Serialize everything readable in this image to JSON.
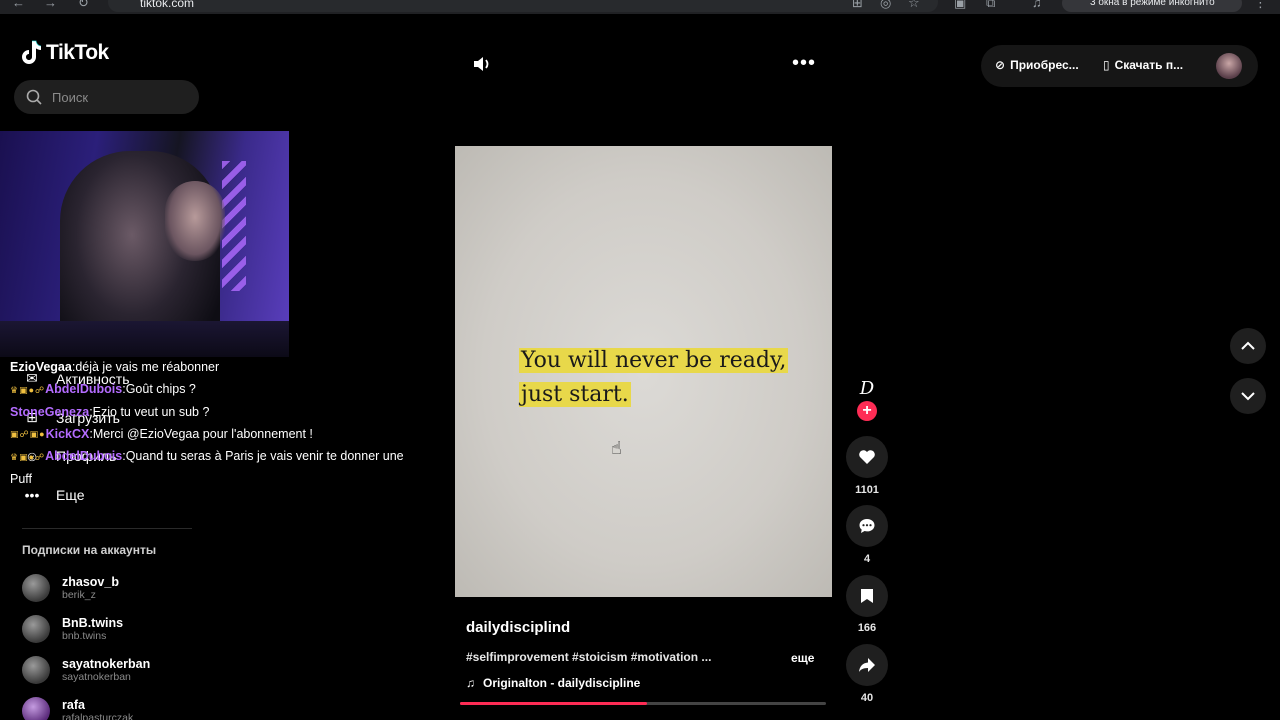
{
  "browser": {
    "url": "tiktok.com",
    "incognito_label": "3 окна в режиме инкогнито"
  },
  "sidebar": {
    "logo": "TikTok",
    "search_placeholder": "Поиск",
    "nav_items": [
      {
        "label": "Активность",
        "icon": "activity-icon"
      },
      {
        "label": "Загрузить",
        "icon": "upload-icon"
      },
      {
        "label": "Профиль",
        "icon": "profile-icon"
      },
      {
        "label": "Еще",
        "icon": "more-icon"
      }
    ],
    "following_title": "Подписки на аккаунты",
    "accounts": [
      {
        "name": "zhasov_b",
        "handle": "berik_z"
      },
      {
        "name": "BnB.twins",
        "handle": "bnb.twins"
      },
      {
        "name": "sayatnokerban",
        "handle": "sayatnokerban"
      },
      {
        "name": "rafa",
        "handle": "rafalpasturczak"
      }
    ]
  },
  "chat": [
    {
      "user": "EzioVegaa",
      "user_color": "#ffffff",
      "message": "déjà je vais me réabonner",
      "badges": ""
    },
    {
      "user": "AbdelDubois",
      "user_color": "#b46cff",
      "message": "Goût chips ?",
      "badges": "♛▣●☍"
    },
    {
      "user": "StoneGeneza",
      "user_color": "#b46cff",
      "message": "Ezio tu veut un sub ?",
      "badges": ""
    },
    {
      "user": "KickCX",
      "user_color": "#b46cff",
      "message": "Merci @EzioVegaa pour l'abonnement !",
      "badges": "▣☍▣●"
    },
    {
      "user": "AbdelDubois",
      "user_color": "#b46cff",
      "message": "Quand tu seras à Paris je vais venir te donner une Puff",
      "badges": "♛▣●☍"
    }
  ],
  "top": {
    "get_coins": "Приобрес...",
    "download_app": "Скачать п..."
  },
  "video": {
    "quote_line1": "You will never be ready,",
    "quote_line2": "just start.",
    "author": "dailydisciplind",
    "hashtags": "#selfimprovement #stoicism #motivation ...",
    "more_label": "еще",
    "music": "Originalton - dailydiscipline",
    "progress_percent": 51,
    "creator_initials": "D"
  },
  "actions": {
    "likes": "1101",
    "comments": "4",
    "saves": "166",
    "shares": "40"
  },
  "colors": {
    "accent": "#fe2c55",
    "highlight": "#e8d84a"
  }
}
